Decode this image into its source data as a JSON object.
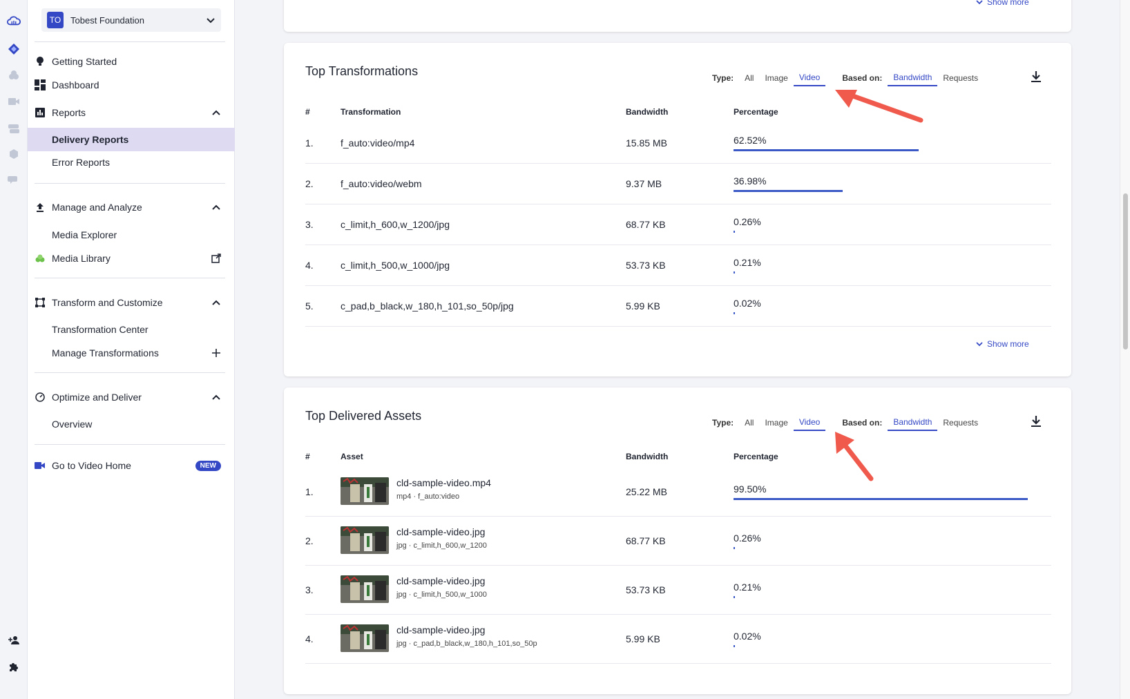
{
  "org": {
    "initials": "TO",
    "name": "Tobest Foundation"
  },
  "sidebar": {
    "items": [
      {
        "label": "Getting Started"
      },
      {
        "label": "Dashboard"
      },
      {
        "label": "Reports"
      },
      {
        "label": "Delivery Reports"
      },
      {
        "label": "Error Reports"
      },
      {
        "label": "Manage and Analyze"
      },
      {
        "label": "Media Explorer"
      },
      {
        "label": "Media Library"
      },
      {
        "label": "Transform and Customize"
      },
      {
        "label": "Transformation Center"
      },
      {
        "label": "Manage Transformations"
      },
      {
        "label": "Optimize and Deliver"
      },
      {
        "label": "Overview"
      },
      {
        "label": "Go to Video Home",
        "badge": "NEW"
      }
    ]
  },
  "top_card": {
    "show_more": "Show more"
  },
  "transformations": {
    "title": "Top Transformations",
    "type_label": "Type:",
    "type_options": [
      "All",
      "Image",
      "Video"
    ],
    "based_label": "Based on:",
    "based_options": [
      "Bandwidth",
      "Requests"
    ],
    "columns": [
      "#",
      "Transformation",
      "Bandwidth",
      "Percentage"
    ],
    "rows": [
      {
        "n": "1.",
        "name": "f_auto:video/mp4",
        "bw": "15.85 MB",
        "pct": "62.52%",
        "frac": 0.6252
      },
      {
        "n": "2.",
        "name": "f_auto:video/webm",
        "bw": "9.37 MB",
        "pct": "36.98%",
        "frac": 0.3698
      },
      {
        "n": "3.",
        "name": "c_limit,h_600,w_1200/jpg",
        "bw": "68.77 KB",
        "pct": "0.26%",
        "frac": 0.0026
      },
      {
        "n": "4.",
        "name": "c_limit,h_500,w_1000/jpg",
        "bw": "53.73 KB",
        "pct": "0.21%",
        "frac": 0.0021
      },
      {
        "n": "5.",
        "name": "c_pad,b_black,w_180,h_101,so_50p/jpg",
        "bw": "5.99 KB",
        "pct": "0.02%",
        "frac": 0.0002
      }
    ],
    "show_more": "Show more"
  },
  "assets": {
    "title": "Top Delivered Assets",
    "type_label": "Type:",
    "type_options": [
      "All",
      "Image",
      "Video"
    ],
    "based_label": "Based on:",
    "based_options": [
      "Bandwidth",
      "Requests"
    ],
    "columns": [
      "#",
      "Asset",
      "Bandwidth",
      "Percentage"
    ],
    "rows": [
      {
        "n": "1.",
        "name": "cld-sample-video.mp4",
        "sub": "mp4 · f_auto:video",
        "bw": "25.22 MB",
        "pct": "99.50%",
        "frac": 0.995
      },
      {
        "n": "2.",
        "name": "cld-sample-video.jpg",
        "sub": "jpg · c_limit,h_600,w_1200",
        "bw": "68.77 KB",
        "pct": "0.26%",
        "frac": 0.0026
      },
      {
        "n": "3.",
        "name": "cld-sample-video.jpg",
        "sub": "jpg · c_limit,h_500,w_1000",
        "bw": "53.73 KB",
        "pct": "0.21%",
        "frac": 0.0021
      },
      {
        "n": "4.",
        "name": "cld-sample-video.jpg",
        "sub": "jpg · c_pad,b_black,w_180,h_101,so_50p",
        "bw": "5.99 KB",
        "pct": "0.02%",
        "frac": 0.0002
      }
    ]
  },
  "colors": {
    "accent": "#3448c5",
    "bar": "#3a58c6",
    "annotation_arrow": "#ef5a4c",
    "active_nav": "#dddaf2"
  }
}
